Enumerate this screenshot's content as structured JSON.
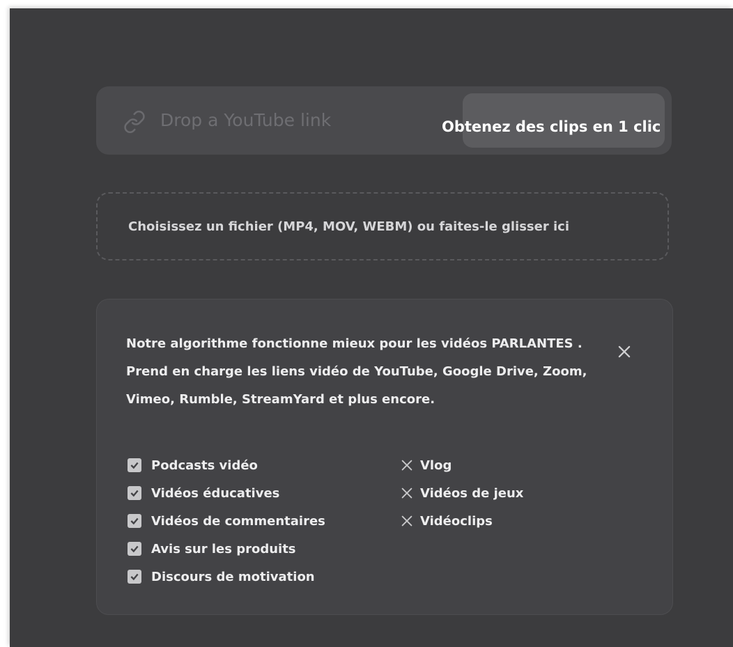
{
  "url_bar": {
    "icon": "link-icon",
    "placeholder": "Drop a YouTube link",
    "button_label": "Obtenez des clips en 1 clic"
  },
  "drop_zone": {
    "text": "Choisissez un fichier (MP4, MOV, WEBM) ou faites-le glisser ici"
  },
  "info_card": {
    "text_before": "Notre algorithme fonctionne mieux pour les vidéos ",
    "emphasis": "PARLANTES",
    "text_after": " . Prend en charge les liens vidéo de YouTube, Google Drive, Zoom, Vimeo, Rumble, StreamYard et plus encore.",
    "close_icon": "close-icon",
    "supported": [
      "Podcasts vidéo",
      "Vidéos éducatives",
      "Vidéos de commentaires",
      "Avis sur les produits",
      "Discours de motivation"
    ],
    "unsupported": [
      "Vlog",
      "Vidéos de jeux",
      "Vidéoclips"
    ]
  },
  "colors": {
    "background": "#3c3c3e",
    "panel": "#4a4a4d",
    "button": "#5c5c5f",
    "text": "#ededee",
    "placeholder": "#6e6e72"
  }
}
